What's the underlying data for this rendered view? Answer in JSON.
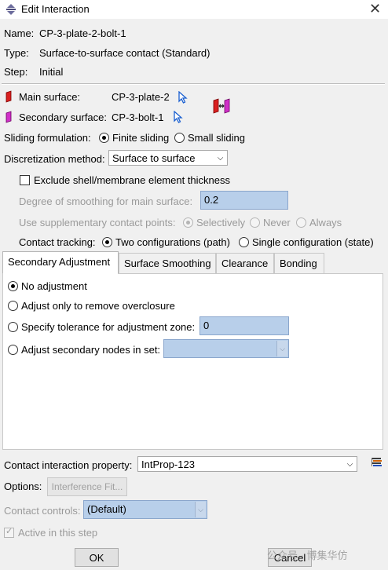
{
  "window": {
    "title": "Edit Interaction",
    "close_label": "✕"
  },
  "info": {
    "name_label": "Name:",
    "name_value": "CP-3-plate-2-bolt-1",
    "type_label": "Type:",
    "type_value": "Surface-to-surface contact (Standard)",
    "step_label": "Step:",
    "step_value": "Initial"
  },
  "surfaces": {
    "main_label": "Main surface:",
    "main_value": "CP-3-plate-2",
    "secondary_label": "Secondary surface:",
    "secondary_value": "CP-3-bolt-1"
  },
  "sliding": {
    "label": "Sliding formulation:",
    "finite": "Finite sliding",
    "small": "Small sliding",
    "selected": "finite"
  },
  "discretization": {
    "label": "Discretization method:",
    "value": "Surface to surface"
  },
  "exclude_shell": {
    "label": "Exclude shell/membrane element thickness",
    "checked": false
  },
  "smoothing": {
    "label": "Degree of smoothing for main surface:",
    "value": "0.2"
  },
  "supplementary": {
    "label": "Use supplementary contact points:",
    "selectively": "Selectively",
    "never": "Never",
    "always": "Always"
  },
  "tracking": {
    "label": "Contact tracking:",
    "two": "Two configurations (path)",
    "single": "Single configuration (state)"
  },
  "tabs": [
    {
      "label": "Secondary Adjustment"
    },
    {
      "label": "Surface Smoothing"
    },
    {
      "label": "Clearance"
    },
    {
      "label": "Bonding"
    }
  ],
  "adjustment": {
    "no_adjustment": "No adjustment",
    "overclosure": "Adjust only to remove overclosure",
    "tolerance": "Specify tolerance for adjustment zone:",
    "tolerance_value": "0",
    "node_set": "Adjust secondary nodes in set:"
  },
  "property": {
    "label": "Contact interaction property:",
    "value": "IntProp-123"
  },
  "options": {
    "label": "Options:",
    "button": "Interference Fit..."
  },
  "controls": {
    "label": "Contact controls:",
    "value": "(Default)"
  },
  "active": {
    "label": "Active in this step",
    "checked": true
  },
  "buttons": {
    "ok": "OK",
    "cancel": "Cancel"
  },
  "watermark": "公众号 · 博集华仿",
  "colors": {
    "field_blue": "#b8cfea",
    "pointer_blue": "#1a5fd0",
    "main_surface_red": "#d92020",
    "secondary_surface_magenta": "#d030c8"
  }
}
